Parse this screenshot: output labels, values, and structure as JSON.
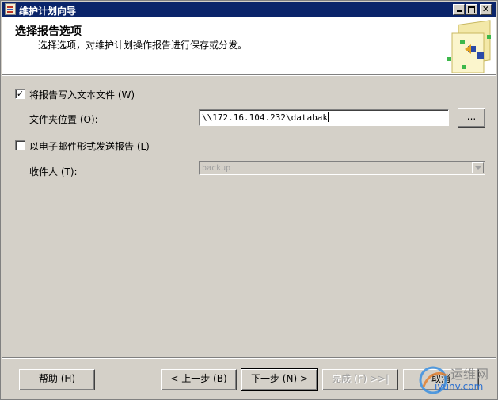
{
  "window": {
    "title": "维护计划向导",
    "buttons": {
      "minimize": "_",
      "maximize": "□",
      "close": "×"
    }
  },
  "header": {
    "title": "选择报告选项",
    "subtitle": "选择选项，对维护计划操作报告进行保存或分发。"
  },
  "options": {
    "write_text_file": {
      "checked": true,
      "label": "将报告写入文本文件 (W)"
    },
    "folder_location": {
      "label": "文件夹位置 (O):",
      "value": "\\\\172.16.104.232\\databak",
      "browse_label": "..."
    },
    "email_report": {
      "checked": false,
      "label": "以电子邮件形式发送报告 (L)"
    },
    "recipient": {
      "label": "收件人 (T):",
      "value": "backup",
      "enabled": false
    }
  },
  "footer": {
    "help": "帮助 (H)",
    "back": "< 上一步 (B)",
    "next": "下一步 (N) >",
    "finish": "完成 (F) >>|",
    "cancel": "取消"
  },
  "watermark": {
    "name": "运维网",
    "url": "iyunv.com"
  },
  "colors": {
    "titlebar": "#0a246a",
    "face": "#d4d0c8",
    "disabled_text": "#a0a0a0"
  }
}
